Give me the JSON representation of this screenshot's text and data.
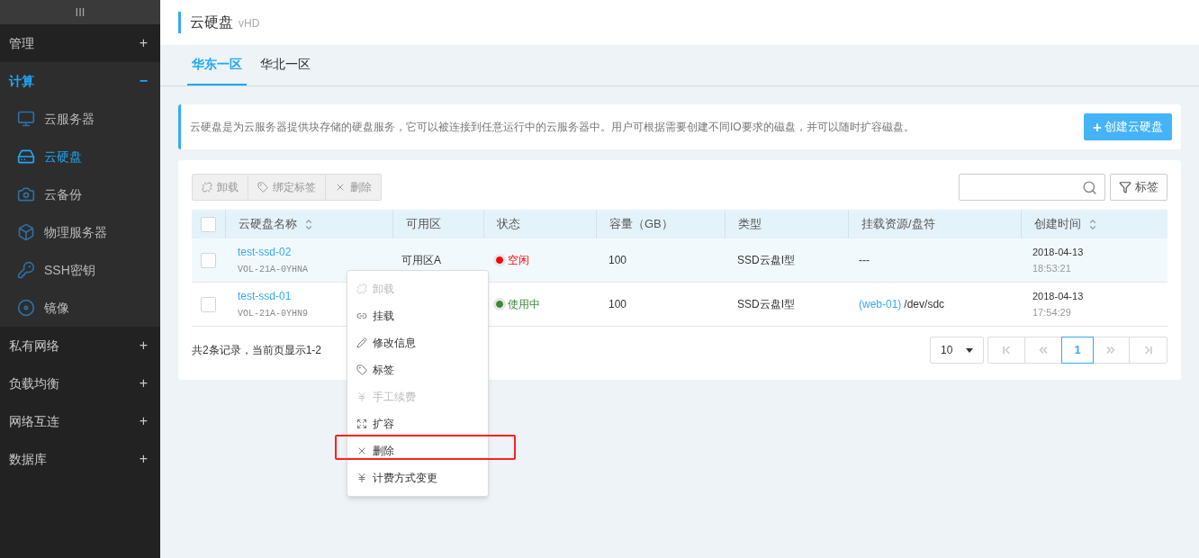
{
  "sidebar": {
    "handle": "III",
    "groups": [
      {
        "label": "管理",
        "expanded": false,
        "toggle": "+"
      },
      {
        "label": "计算",
        "expanded": true,
        "toggle": "−",
        "children": [
          {
            "label": "云服务器",
            "selected": false
          },
          {
            "label": "云硬盘",
            "selected": true
          },
          {
            "label": "云备份",
            "selected": false
          },
          {
            "label": "物理服务器",
            "selected": false
          },
          {
            "label": "SSH密钥",
            "selected": false
          },
          {
            "label": "镜像",
            "selected": false
          }
        ]
      },
      {
        "label": "私有网络",
        "expanded": false,
        "toggle": "+"
      },
      {
        "label": "负载均衡",
        "expanded": false,
        "toggle": "+"
      },
      {
        "label": "网络互连",
        "expanded": false,
        "toggle": "+"
      },
      {
        "label": "数据库",
        "expanded": false,
        "toggle": "+"
      }
    ]
  },
  "header": {
    "title": "云硬盘",
    "subtitle": "vHD"
  },
  "tabs": [
    {
      "label": "华东一区",
      "selected": true
    },
    {
      "label": "华北一区",
      "selected": false
    }
  ],
  "info": {
    "text": "云硬盘是为云服务器提供块存储的硬盘服务，它可以被连接到任意运行中的云服务器中。用户可根据需要创建不同IO要求的磁盘，并可以随时扩容磁盘。",
    "create_button": "创建云硬盘",
    "create_icon": "+"
  },
  "toolbar": [
    {
      "label": "卸载"
    },
    {
      "label": "绑定标签"
    },
    {
      "label": "删除"
    }
  ],
  "tag_filter": "标签",
  "table": {
    "columns": [
      {
        "label": "云硬盘名称",
        "sortable": true
      },
      {
        "label": "可用区",
        "sortable": false
      },
      {
        "label": "状态",
        "sortable": false
      },
      {
        "label": "容量（GB）",
        "sortable": false
      },
      {
        "label": "类型",
        "sortable": false
      },
      {
        "label": "挂载资源/盘符",
        "sortable": false
      },
      {
        "label": "创建时间",
        "sortable": true
      }
    ],
    "header_checked": false,
    "rows": [
      {
        "checked": false,
        "highlighted": true,
        "name": "test-ssd-02",
        "id": "VOL-21A-0YHNA",
        "zone": "可用区A",
        "status": "空闲",
        "color": "#ff0000",
        "capacity": "100",
        "type": "SSD云盘I型",
        "mount_link": "",
        "mount": "---",
        "date": "2018-04-13",
        "time": "18:53:21"
      },
      {
        "checked": false,
        "highlighted": false,
        "name": "test-ssd-01",
        "id": "VOL-21A-0YHN9",
        "zone": "",
        "status": "使用中",
        "color": "#3a8a3a",
        "capacity": "100",
        "type": "SSD云盘I型",
        "mount_link": "(web-01)",
        "mount": "/dev/sdc",
        "date": "2018-04-13",
        "time": "17:54:29"
      }
    ]
  },
  "summary": "共2条记录，当前页显示1-2",
  "pagination": {
    "page_size": "10",
    "pages": [
      {
        "label": "1",
        "selected": true
      }
    ]
  },
  "context_menu": [
    {
      "label": "卸载",
      "disabled": true,
      "highlighted": false
    },
    {
      "label": "挂载",
      "disabled": false,
      "highlighted": false
    },
    {
      "label": "修改信息",
      "disabled": false,
      "highlighted": false
    },
    {
      "label": "标签",
      "disabled": false,
      "highlighted": false
    },
    {
      "label": "手工续费",
      "disabled": true,
      "highlighted": false
    },
    {
      "label": "扩容",
      "disabled": false,
      "highlighted": false
    },
    {
      "label": "删除",
      "disabled": false,
      "highlighted": true
    },
    {
      "label": "计费方式变更",
      "disabled": false,
      "highlighted": false
    }
  ]
}
